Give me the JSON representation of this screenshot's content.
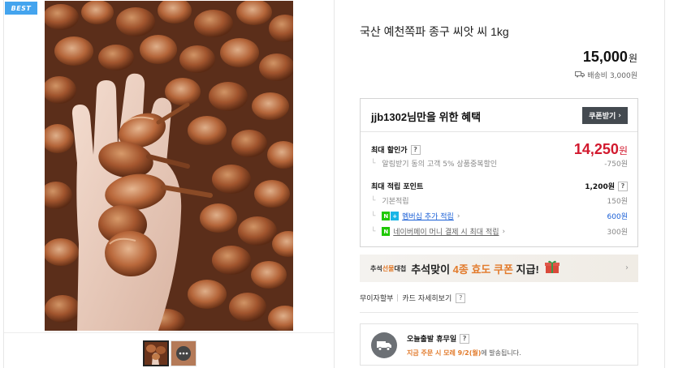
{
  "gallery": {
    "badge": "BEST",
    "thumbnails": [
      {
        "name": "shallot-photo"
      },
      {
        "name": "chat-bubble"
      }
    ]
  },
  "product": {
    "title": "국산 예천쪽파 종구 씨앗 씨 1kg",
    "price": "15,000",
    "price_unit": "원",
    "shipping": "배송비 3,000원"
  },
  "benefits": {
    "title": "jjb1302님만을 위한 혜택",
    "coupon_button": "쿠폰받기",
    "max_discount_label": "최대 할인가",
    "max_discount_price": "14,250",
    "max_discount_unit": "원",
    "alarm_discount_label": "알림받기 동의 고객 5% 상품중복할인",
    "alarm_discount_value": "-750원",
    "max_points_label": "최대 적립 포인트",
    "max_points_value": "1,200원",
    "basic_points_label": "기본적립",
    "basic_points_value": "150원",
    "membership_label": "멤버십 추가 적립",
    "membership_value": "600원",
    "npay_label": "네이버페이 머니 결제 시 최대 적립",
    "npay_value": "300원"
  },
  "banner": {
    "tag_prefix": "추석",
    "tag_highlight": "선물",
    "tag_suffix": "대첩",
    "msg_prefix": "추석맞이 ",
    "msg_highlight": "4종 효도 쿠폰",
    "msg_suffix": " 지급!"
  },
  "links": {
    "interest_free": "무이자할부",
    "card_benefits": "카드 자세히보기"
  },
  "delivery": {
    "title": "오늘출발 휴무일",
    "note_highlight": "지금 주문 시 모레 9/2(월)",
    "note_suffix": "에 발송됩니다."
  },
  "colors": {
    "accent_red": "#d2192e",
    "accent_orange": "#e27b2c",
    "link_blue": "#1a5fd6",
    "badge_blue": "#44a4ee",
    "naver_green": "#1ec800"
  }
}
